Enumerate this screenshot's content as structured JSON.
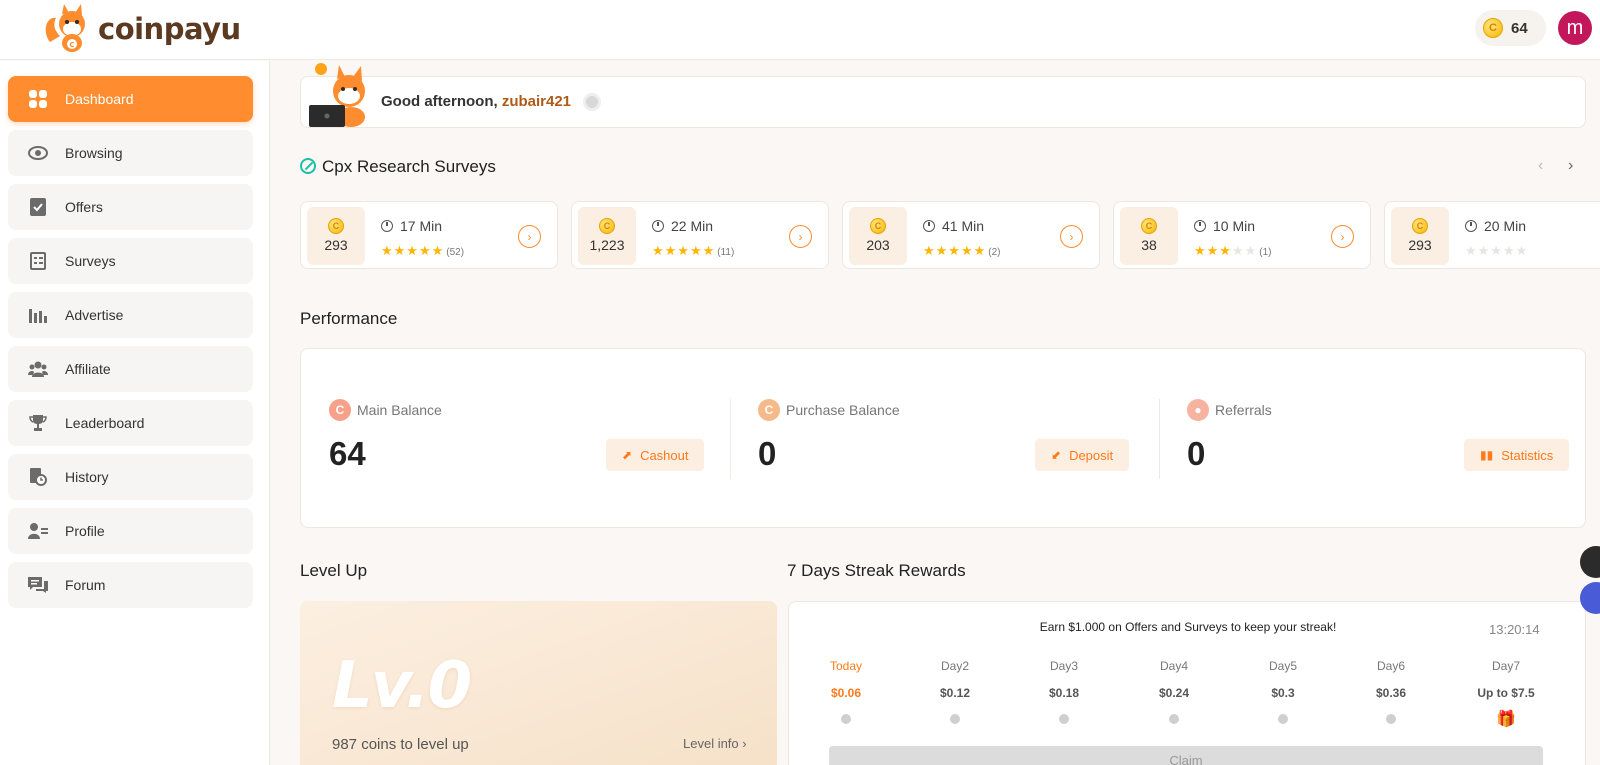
{
  "brand": {
    "name": "coinpayu"
  },
  "header": {
    "coin_balance": "64",
    "avatar_letter": "m"
  },
  "sidebar": {
    "items": [
      {
        "label": "Dashboard",
        "icon": "dashboard-icon",
        "active": true
      },
      {
        "label": "Browsing",
        "icon": "eye-icon"
      },
      {
        "label": "Offers",
        "icon": "offers-icon"
      },
      {
        "label": "Surveys",
        "icon": "surveys-icon"
      },
      {
        "label": "Advertise",
        "icon": "chart-bars-icon"
      },
      {
        "label": "Affiliate",
        "icon": "users-icon"
      },
      {
        "label": "Leaderboard",
        "icon": "trophy-icon"
      },
      {
        "label": "History",
        "icon": "history-icon"
      },
      {
        "label": "Profile",
        "icon": "profile-icon"
      },
      {
        "label": "Forum",
        "icon": "forum-icon"
      }
    ]
  },
  "greeting": {
    "prefix": "Good afternoon,",
    "username": "zubair421"
  },
  "surveys": {
    "title": "Cpx Research Surveys",
    "prev": "‹",
    "next": "›",
    "cards": [
      {
        "reward": "293",
        "time": "17 Min",
        "rating": 5,
        "count": "(52)"
      },
      {
        "reward": "1,223",
        "time": "22 Min",
        "rating": 5,
        "count": "(11)"
      },
      {
        "reward": "203",
        "time": "41 Min",
        "rating": 5,
        "count": "(2)"
      },
      {
        "reward": "38",
        "time": "10 Min",
        "rating": 3,
        "count": "(1)"
      },
      {
        "reward": "293",
        "time": "20 Min",
        "rating": 0,
        "count": ""
      }
    ]
  },
  "performance": {
    "title": "Performance",
    "main_balance": {
      "label": "Main Balance",
      "value": "64",
      "button": "Cashout"
    },
    "purchase_balance": {
      "label": "Purchase Balance",
      "value": "0",
      "button": "Deposit"
    },
    "referrals": {
      "label": "Referrals",
      "value": "0",
      "button": "Statistics"
    }
  },
  "level": {
    "title": "Level Up",
    "level_text": "Lv.0",
    "coins_text": "987 coins to level up",
    "info_link": "Level info ›"
  },
  "streak": {
    "title": "7 Days Streak Rewards",
    "message": "Earn $1.000 on Offers and Surveys to keep your streak!",
    "timer": "13:20:14",
    "days": [
      {
        "name": "Today",
        "amount": "$0.06"
      },
      {
        "name": "Day2",
        "amount": "$0.12"
      },
      {
        "name": "Day3",
        "amount": "$0.18"
      },
      {
        "name": "Day4",
        "amount": "$0.24"
      },
      {
        "name": "Day5",
        "amount": "$0.3"
      },
      {
        "name": "Day6",
        "amount": "$0.36"
      },
      {
        "name": "Day7",
        "amount": "Up to $7.5"
      }
    ],
    "claim": "Claim"
  },
  "colors": {
    "accent": "#ff8c2e",
    "brand_brown": "#5c3a21",
    "star": "#ffb400",
    "teal": "#1cc0a6"
  }
}
